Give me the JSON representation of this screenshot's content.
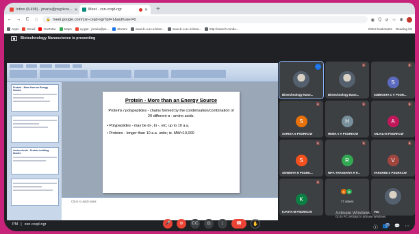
{
  "browser": {
    "tabs": [
      {
        "label": "Inbox (8,498) - jmaria@psgrkcw...",
        "favicon_color": "#ea4335",
        "active": false
      },
      {
        "label": "Meet - zsn-cxqd-ngr",
        "favicon_color": "#00897b",
        "active": true
      }
    ],
    "new_tab": "+",
    "nav": {
      "back": "←",
      "forward": "→",
      "reload": "C",
      "home": "⌂"
    },
    "url": "meet.google.com/zsn-cxqd-ngr?pli=1&authuser=0",
    "toolbar_icons": [
      "◉",
      "Q",
      "⊘",
      "☆",
      "✱"
    ],
    "bookmarks": [
      {
        "label": "Apps",
        "color": "#5f6368"
      },
      {
        "label": "Gmail",
        "color": "#ea4335"
      },
      {
        "label": "YouTube",
        "color": "#ff0000"
      },
      {
        "label": "Maps",
        "color": "#34a853"
      },
      {
        "label": "cg ppt - jmaria@ps...",
        "color": "#ea4335"
      },
      {
        "label": "Stream",
        "color": "#1a73e8"
      },
      {
        "label": "www.b-u.ac.in/dow...",
        "color": "#5f6368"
      },
      {
        "label": "www.b-u.ac.in/dow...",
        "color": "#5f6368"
      },
      {
        "label": "http://search.condu...",
        "color": "#5f6368"
      }
    ],
    "bookmarks_right": [
      "Other bookmarks",
      "Reading list"
    ]
  },
  "meet": {
    "presenting_banner": "Biotechnology Nanoscience is presenting",
    "slide": {
      "title": "Protein - More than an Energy Source",
      "lead": "Proteins / polypeptides  - chains formed by the condensation/combination of 20 different α - amino acids.",
      "bullets": [
        "• Polypeptides  - may be di-, tri -, etc; up to 10 a.a.",
        "• Proteins  - longer than 10 a.a. units; ie. MW>10,000"
      ],
      "notes_placeholder": "Click to add notes",
      "thumbnails": [
        {
          "title": "Protein - More than an Energy Source"
        },
        {
          "title": "Amino Acids - Protein building blocks"
        }
      ]
    },
    "participants": [
      {
        "name": "Biotechnology Nano...",
        "initial": "",
        "color": "",
        "kind": "photo",
        "speaking": true
      },
      {
        "name": "Biotechnology Nano...",
        "initial": "",
        "color": "",
        "kind": "photo",
        "speaking": false
      },
      {
        "name": "SUBIKSHA C V PSGR...",
        "initial": "S",
        "color": "#5c6bc0",
        "kind": "initial",
        "speaking": false
      },
      {
        "name": "SARIGA S PSGRKCW",
        "initial": "S",
        "color": "#e8710a",
        "kind": "initial",
        "speaking": false
      },
      {
        "name": "HEMA V A PSGRKCW",
        "initial": "H",
        "color": "#78909c",
        "kind": "initial",
        "speaking": false
      },
      {
        "name": "ANJALI B PSGRKCW",
        "initial": "A",
        "color": "#c2185b",
        "kind": "initial",
        "speaking": false
      },
      {
        "name": "SOWMIYA N PSGRK...",
        "initial": "S",
        "color": "#f4511e",
        "kind": "initial",
        "speaking": false
      },
      {
        "name": "RIFA THANSHIYA R P...",
        "initial": "R",
        "color": "#33a853",
        "kind": "initial",
        "speaking": false
      },
      {
        "name": "VARSHINI S PSGRKCW",
        "initial": "V",
        "color": "#a1453f",
        "kind": "initial",
        "speaking": false
      },
      {
        "name": "KAVIYA M PSGRKCW",
        "initial": "K",
        "color": "#0b8043",
        "kind": "initial",
        "speaking": false
      },
      {
        "name": "",
        "others_label": "77 others",
        "kind": "others",
        "speaking": false
      },
      {
        "name": "You",
        "initial": "",
        "color": "",
        "kind": "photo",
        "speaking": false
      }
    ],
    "meeting_time": "PM",
    "meeting_code": "zsn-cxqd-ngr",
    "controls": {
      "mic": "🎤",
      "cam": "⊘",
      "captions": "CC",
      "present": "⊡",
      "more": "⋮",
      "hangup": "☎",
      "raise": "✋"
    },
    "bottom_right": {
      "info": "ⓘ",
      "people": "👥",
      "people_count": "82",
      "chat": "💬",
      "activities": "⋯"
    }
  },
  "os": {
    "activate_title": "Activate Windows",
    "activate_sub": "Go to PC settings to activate Windows."
  }
}
